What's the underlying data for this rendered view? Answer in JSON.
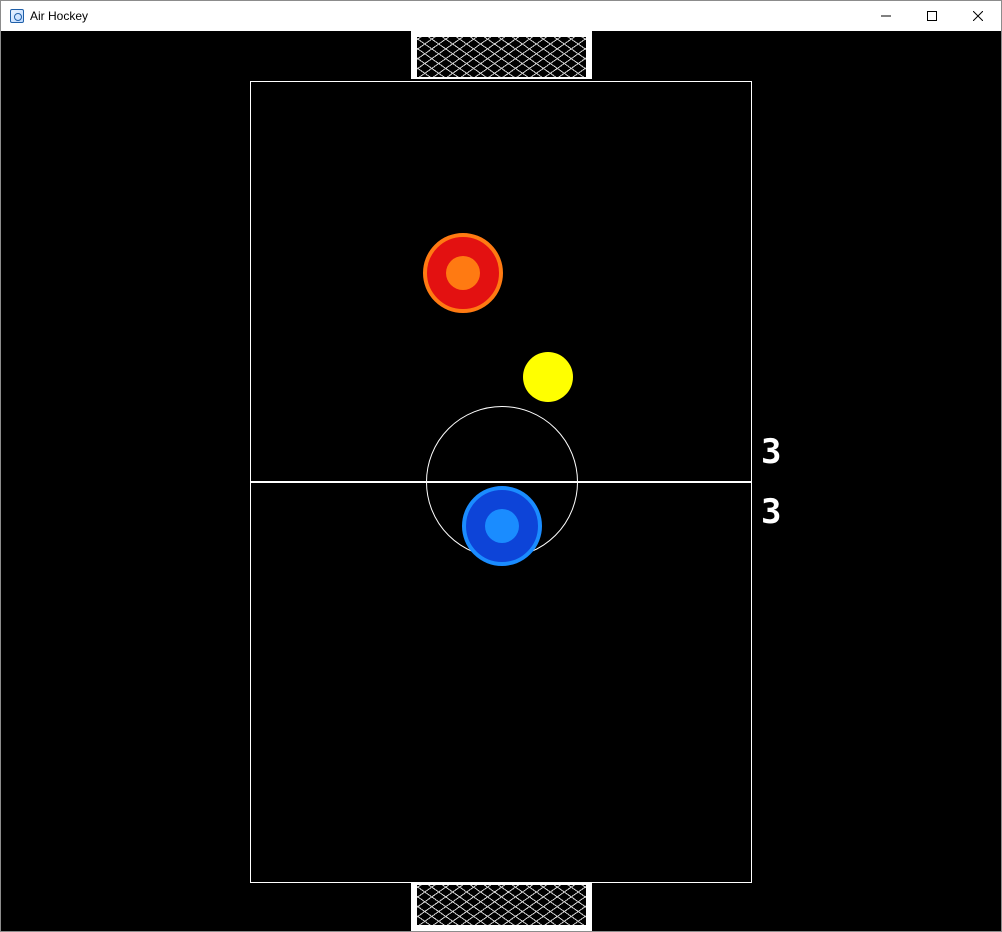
{
  "window": {
    "title": "Air Hockey",
    "controls": {
      "minimize_icon": "minimize-icon",
      "maximize_icon": "maximize-icon",
      "close_icon": "close-icon"
    }
  },
  "game": {
    "score_top": "3",
    "score_bottom": "3",
    "colors": {
      "background": "#000000",
      "lines": "#ffffff",
      "top_mallet_outer": "#e31111",
      "top_mallet_inner": "#ff7a12",
      "bottom_mallet_outer": "#0d44d8",
      "bottom_mallet_inner": "#1a8cff",
      "puck": "#ffff00"
    }
  }
}
